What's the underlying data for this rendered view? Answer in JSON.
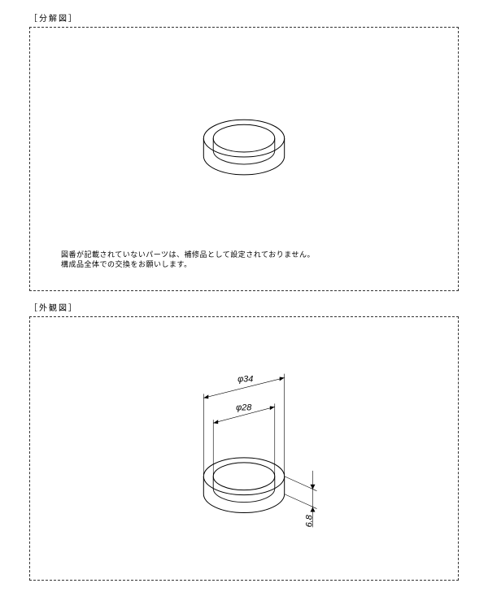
{
  "sections": {
    "exploded": {
      "label": "［分解図］"
    },
    "appearance": {
      "label": "［外観図］"
    }
  },
  "note": {
    "line1": "図番が記載されていないパーツは、補修品として設定されておりません。",
    "line2": "構成品全体での交換をお願いします。"
  },
  "dimensions": {
    "outer_diameter": "φ34",
    "inner_diameter": "φ28",
    "thickness": "6.8"
  }
}
